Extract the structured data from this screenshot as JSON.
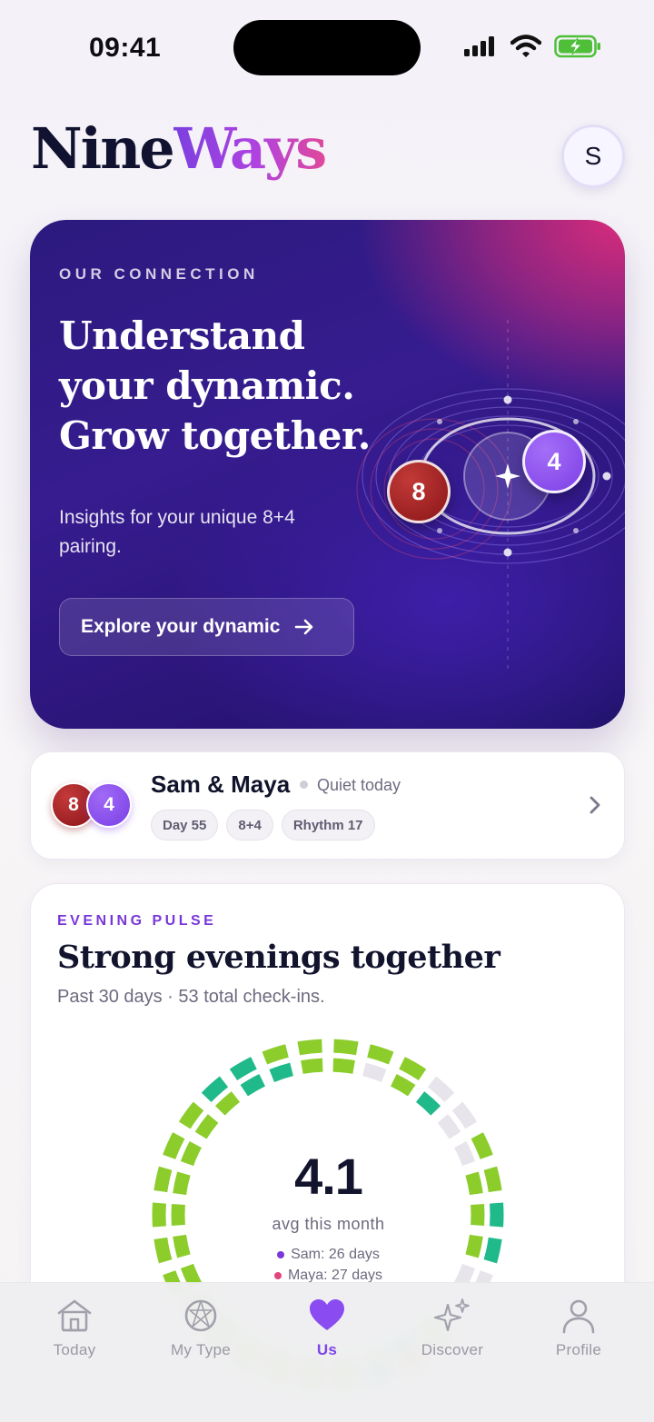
{
  "status_bar": {
    "time": "09:41"
  },
  "header": {
    "logo_part1": "Nine",
    "logo_part2": "Ways",
    "avatar_initial": "S"
  },
  "hero": {
    "eyebrow": "OUR CONNECTION",
    "title_lines": [
      "Understand",
      "your dynamic.",
      "Grow together."
    ],
    "subtitle": "Insights for your unique 8+4 pairing.",
    "cta_label": "Explore your dynamic",
    "badge_a": "8",
    "badge_b": "4"
  },
  "couple": {
    "badge_a": "8",
    "badge_b": "4",
    "names": "Sam & Maya",
    "status": "Quiet today",
    "chips": [
      "Day 55",
      "8+4",
      "Rhythm 17"
    ]
  },
  "pulse": {
    "eyebrow": "EVENING PULSE",
    "title": "Strong evenings together",
    "subtitle": "Past 30 days · 53 total check-ins.",
    "avg_value": "4.1",
    "avg_label": "avg this month",
    "legend": [
      {
        "text": "Sam: 26 days",
        "color": "#7a37d8"
      },
      {
        "text": "Maya: 27 days",
        "color": "#e0457d"
      }
    ]
  },
  "colors": {
    "accent": "#7d44e8",
    "type8": "#9b1c1f",
    "type4": "#8a4cf0",
    "ring_green": "#8ccd2c",
    "ring_teal": "#20b98a",
    "ring_orange": "#f39a1b",
    "ring_empty": "#e7e4ec"
  },
  "tabs": [
    {
      "label": "Today",
      "icon": "home-icon",
      "active": false
    },
    {
      "label": "My Type",
      "icon": "enneagram-icon",
      "active": false
    },
    {
      "label": "Us",
      "icon": "heart-icon",
      "active": true
    },
    {
      "label": "Discover",
      "icon": "sparkles-icon",
      "active": false
    },
    {
      "label": "Profile",
      "icon": "person-icon",
      "active": false
    }
  ]
}
